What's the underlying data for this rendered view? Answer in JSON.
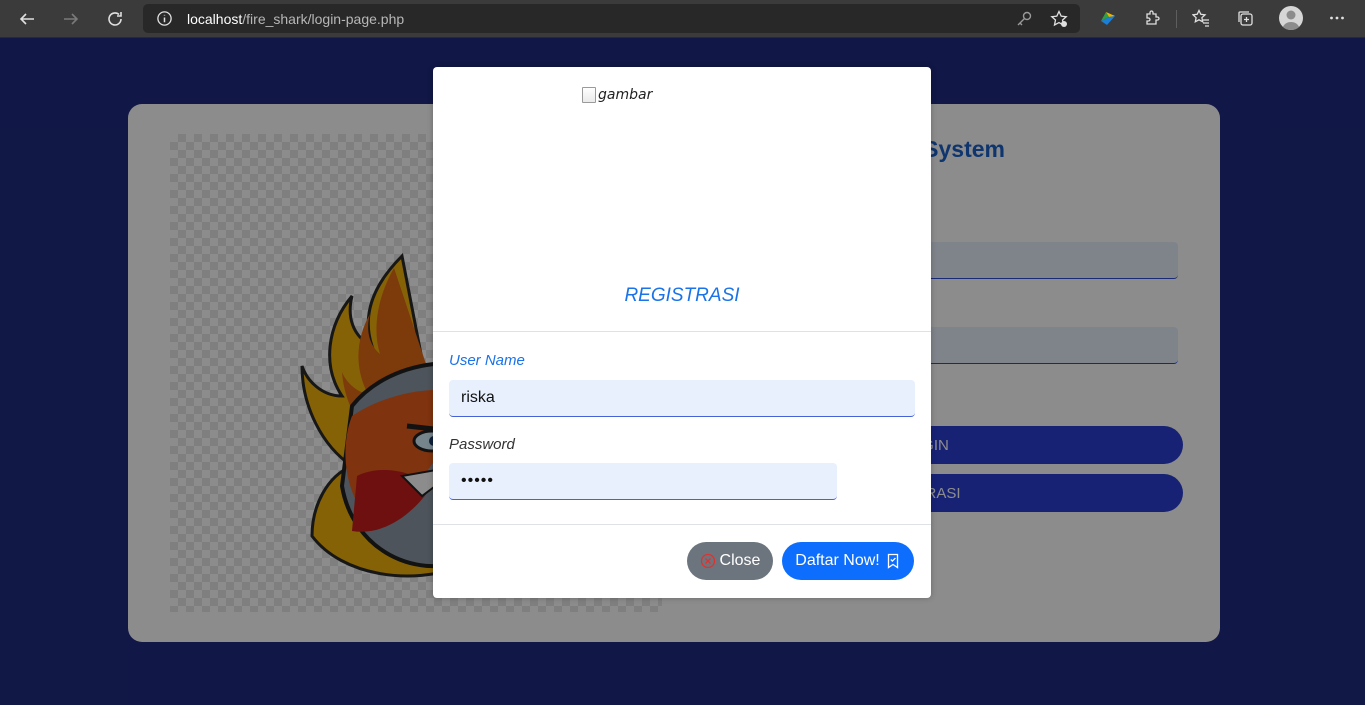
{
  "browser": {
    "url_host": "localhost",
    "url_path": "/fire_shark/login-page.php",
    "icons": [
      "back-icon",
      "forward-icon",
      "refresh-icon",
      "info-icon",
      "key-icon",
      "favorite-add-icon",
      "extension-color-icon",
      "extensions-icon",
      "favorites-icon",
      "collections-icon",
      "profile-icon",
      "more-icon"
    ]
  },
  "background": {
    "system_title": "System",
    "login_label": "LOGIN",
    "register_label": "GISTRASI"
  },
  "modal": {
    "image_alt": "gambar",
    "title": "REGISTRASI",
    "username_label": "User Name",
    "username_value": "riska",
    "password_label": "Password",
    "password_value": "•••••",
    "close_label": "Close",
    "submit_label": "Daftar Now!"
  },
  "colors": {
    "page_bg": "#202b80",
    "accent": "#1a73e8",
    "primary_button": "#0d6efd",
    "secondary_button": "#6c757d",
    "input_bg": "#e8f0fe"
  }
}
